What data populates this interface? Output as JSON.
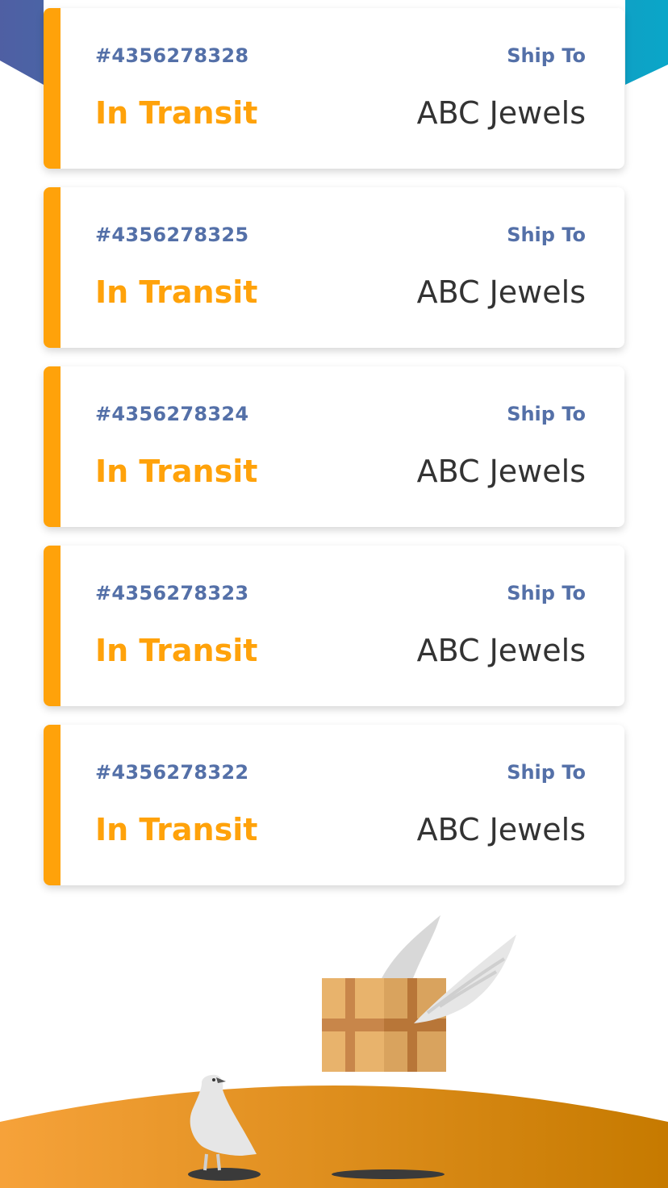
{
  "colors": {
    "header_gradient_start": "#4f5fa3",
    "header_gradient_end": "#0aa6c8",
    "accent": "#ffa20a",
    "label_blue": "#5470a8",
    "recipient_text": "#333333",
    "ground_start": "#f6a23a",
    "ground_end": "#c67a00"
  },
  "shipments": [
    {
      "id": "#4356278328",
      "ship_to_label": "Ship To",
      "status": "In Transit",
      "recipient": "ABC Jewels"
    },
    {
      "id": "#4356278325",
      "ship_to_label": "Ship To",
      "status": "In Transit",
      "recipient": "ABC Jewels"
    },
    {
      "id": "#4356278324",
      "ship_to_label": "Ship To",
      "status": "In Transit",
      "recipient": "ABC Jewels"
    },
    {
      "id": "#4356278323",
      "ship_to_label": "Ship To",
      "status": "In Transit",
      "recipient": "ABC Jewels"
    },
    {
      "id": "#4356278322",
      "ship_to_label": "Ship To",
      "status": "In Transit",
      "recipient": "ABC Jewels"
    }
  ],
  "illustration": {
    "icons": [
      "winged-box-icon",
      "pigeon-icon"
    ]
  }
}
